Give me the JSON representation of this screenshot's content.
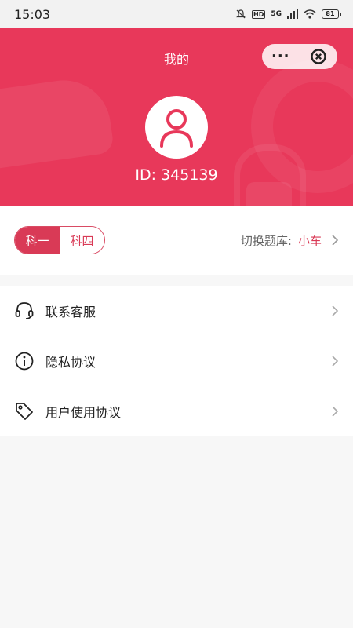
{
  "status_bar": {
    "time": "15:03",
    "network": "5G",
    "hd": "HD",
    "battery": "81"
  },
  "header": {
    "title": "我的",
    "user_id": "ID: 345139",
    "accent_color": "#e8385a"
  },
  "subject": {
    "tabs": [
      {
        "label": "科一",
        "active": true
      },
      {
        "label": "科四",
        "active": false
      }
    ],
    "bank_label": "切换题库:",
    "bank_value": "小车"
  },
  "menu": {
    "items": [
      {
        "label": "联系客服",
        "icon": "headset-icon"
      },
      {
        "label": "隐私协议",
        "icon": "info-icon"
      },
      {
        "label": "用户使用协议",
        "icon": "tag-icon"
      }
    ]
  }
}
